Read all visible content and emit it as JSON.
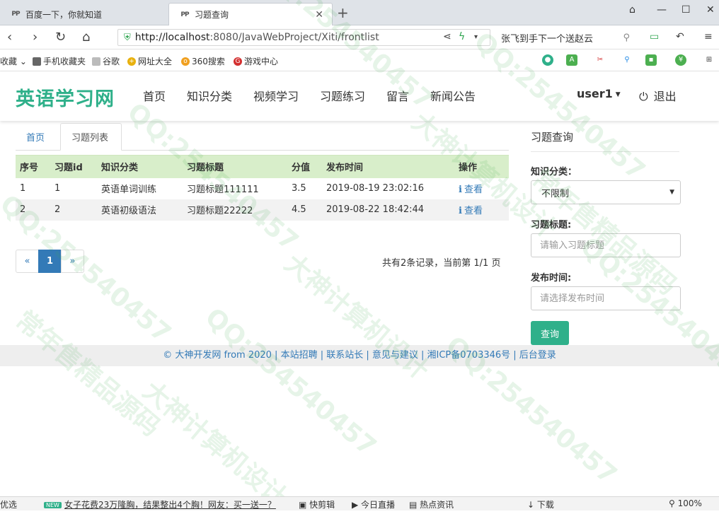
{
  "browser": {
    "tabs": [
      {
        "title": "百度一下，你就知道",
        "icon": "paw-icon"
      },
      {
        "title": "习题查询",
        "icon": "paw-icon"
      }
    ],
    "url_host": "http://localhost",
    "url_path": ":8080/JavaWebProject/Xiti/frontlist",
    "search_text": "张飞到手下一个送赵云",
    "bookmarks": [
      "收藏",
      "手机收藏夹",
      "谷歌",
      "网址大全",
      "360搜索",
      "游戏中心"
    ]
  },
  "site": {
    "logo": "英语学习网",
    "menu": [
      "首页",
      "知识分类",
      "视频学习",
      "习题练习",
      "留言",
      "新闻公告"
    ],
    "user": "user1",
    "logout": "退出"
  },
  "breadcrumb": {
    "home": "首页",
    "current": "习题列表"
  },
  "table": {
    "headers": [
      "序号",
      "习题id",
      "知识分类",
      "习题标题",
      "分值",
      "发布时间",
      "操作"
    ],
    "rows": [
      {
        "no": "1",
        "id": "1",
        "category": "英语单词训练",
        "title": "习题标题111111",
        "score": "3.5",
        "time": "2019-08-19 23:02:16",
        "action": "查看"
      },
      {
        "no": "2",
        "id": "2",
        "category": "英语初级语法",
        "title": "习题标题22222",
        "score": "4.5",
        "time": "2019-08-22 18:42:44",
        "action": "查看"
      }
    ]
  },
  "pager": {
    "prev": "«",
    "current": "1",
    "next": "»",
    "summary": "共有2条记录，当前第 1/1 页"
  },
  "sidebar": {
    "title": "习题查询",
    "category_label": "知识分类：",
    "category_value": "不限制",
    "title_label": "习题标题:",
    "title_placeholder": "请输入习题标题",
    "time_label": "发布时间:",
    "time_placeholder": "请选择发布时间",
    "query_button": "查询"
  },
  "footer": {
    "text": "© 大神开发网 from 2020 | 本站招聘 | 联系站长 | 意见与建议 | 湘ICP备0703346号 | 后台登录"
  },
  "statusbar": {
    "left": "优选",
    "badge": "NEW",
    "news": "女子花费23万隆胸，结果整出4个胸！网友：买一送一？",
    "items": [
      "快剪辑",
      "今日直播",
      "热点资讯",
      "下载",
      "100%"
    ]
  },
  "watermarks": {
    "qq": "QQ:254540457",
    "a": "大神计算机设计",
    "b": "常年售精品源码"
  },
  "colors": {
    "brand": "#2fb08a",
    "link": "#337ab7",
    "table_header": "#d8eeca"
  }
}
